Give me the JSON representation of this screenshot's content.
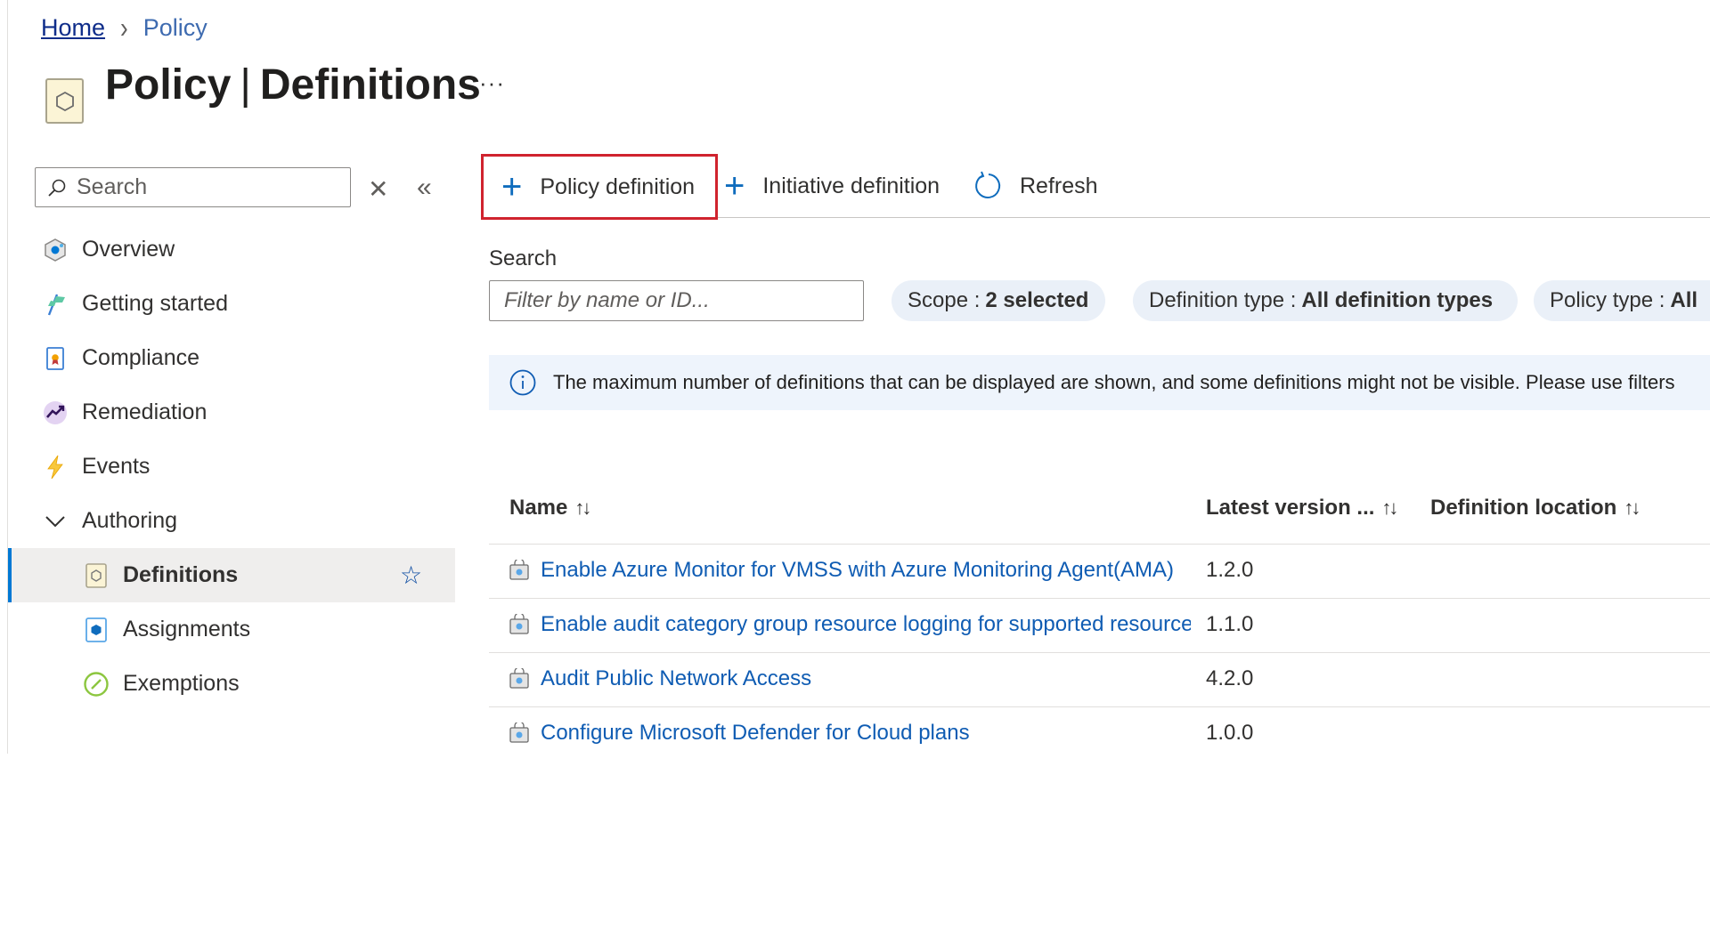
{
  "breadcrumb": {
    "home": "Home",
    "current": "Policy"
  },
  "page": {
    "title_main": "Policy",
    "title_divider": "|",
    "title_sub": "Definitions",
    "more": "···"
  },
  "sidebar": {
    "search_placeholder": "Search",
    "clear_glyph": "✕",
    "collapse_glyph": "«",
    "items": [
      {
        "label": "Overview",
        "icon": "overview-icon"
      },
      {
        "label": "Getting started",
        "icon": "getting-started-icon"
      },
      {
        "label": "Compliance",
        "icon": "compliance-icon"
      },
      {
        "label": "Remediation",
        "icon": "remediation-icon"
      },
      {
        "label": "Events",
        "icon": "events-icon"
      },
      {
        "label": "Authoring",
        "icon": "chevron-down-icon",
        "expanded": true
      },
      {
        "label": "Definitions",
        "icon": "definitions-icon",
        "selected": true,
        "favorite_glyph": "☆"
      },
      {
        "label": "Assignments",
        "icon": "assignments-icon"
      },
      {
        "label": "Exemptions",
        "icon": "exemptions-icon"
      }
    ]
  },
  "toolbar": {
    "policy_definition": "Policy definition",
    "initiative_definition": "Initiative definition",
    "refresh": "Refresh",
    "plus_glyph": "+"
  },
  "filters": {
    "search_label": "Search",
    "search_placeholder": "Filter by name or ID...",
    "scope": {
      "key": "Scope :",
      "value": "2 selected"
    },
    "definition_type": {
      "key": "Definition type :",
      "value": "All definition types"
    },
    "policy_type": {
      "key": "Policy type :",
      "value": "All"
    }
  },
  "info_banner": {
    "text": "The maximum number of definitions that can be displayed are shown, and some definitions might not be visible. Please use filters"
  },
  "table": {
    "columns": {
      "name": "Name",
      "version": "Latest version ...",
      "location": "Definition location",
      "sort_glyph": "↑↓"
    },
    "rows": [
      {
        "name": "Enable Azure Monitor for VMSS with Azure Monitoring Agent(AMA)",
        "version": "1.2.0",
        "location": ""
      },
      {
        "name": "Enable audit category group resource logging for supported resources",
        "version": "1.1.0",
        "location": ""
      },
      {
        "name": "Audit Public Network Access",
        "version": "4.2.0",
        "location": ""
      },
      {
        "name": "Configure Microsoft Defender for Cloud plans",
        "version": "1.0.0",
        "location": ""
      }
    ]
  },
  "colors": {
    "accent": "#0078d4",
    "link": "#0f5cb3",
    "highlight_border": "#d0232e",
    "pill_bg": "#eaf0f8",
    "banner_bg": "#eef4fc"
  }
}
